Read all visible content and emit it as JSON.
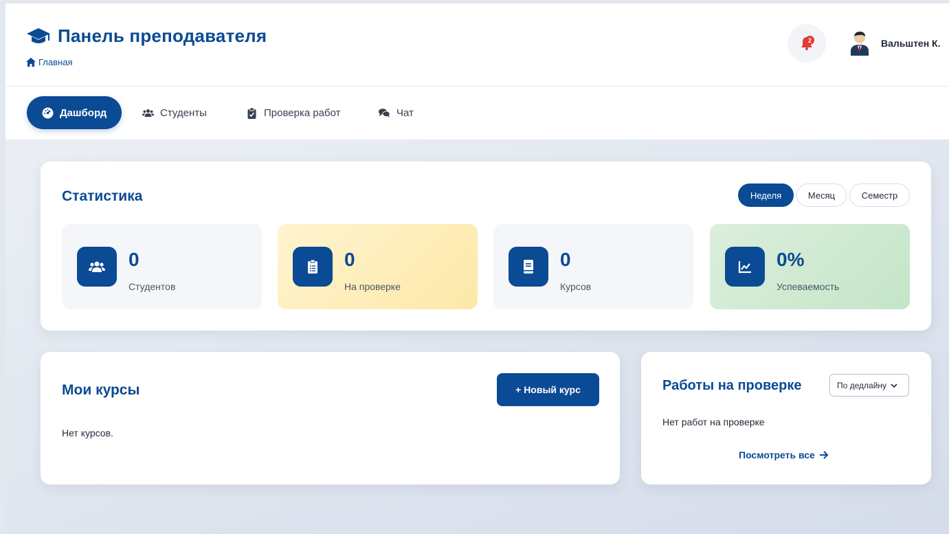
{
  "header": {
    "title": "Панель преподавателя",
    "breadcrumb": "Главная",
    "notifications_count": "2",
    "user_name": "Вальштен К."
  },
  "tabs": [
    {
      "label": "Дашборд",
      "icon": "dashboard-icon",
      "active": true
    },
    {
      "label": "Студенты",
      "icon": "users-icon",
      "active": false
    },
    {
      "label": "Проверка работ",
      "icon": "clipboard-icon",
      "active": false
    },
    {
      "label": "Чат",
      "icon": "chat-icon",
      "active": false
    }
  ],
  "stats": {
    "title": "Статистика",
    "periods": [
      "Неделя",
      "Месяц",
      "Семестр"
    ],
    "active_period": "Неделя",
    "cards": [
      {
        "value": "0",
        "label": "Студентов",
        "icon": "users-icon"
      },
      {
        "value": "0",
        "label": "На проверке",
        "icon": "clipboard-list-icon"
      },
      {
        "value": "0",
        "label": "Курсов",
        "icon": "book-icon"
      },
      {
        "value": "0%",
        "label": "Успеваемость",
        "icon": "chart-line-icon"
      }
    ]
  },
  "courses": {
    "title": "Мои курсы",
    "new_button": "+ Новый курс",
    "empty": "Нет курсов."
  },
  "reviews": {
    "title": "Работы на проверке",
    "sort_selected": "По дедлайну",
    "empty": "Нет работ на проверке",
    "view_all": "Посмотреть все"
  },
  "colors": {
    "primary": "#0b4a94",
    "badge": "#e53935",
    "warning_bg": "#fde8a8",
    "success_bg": "#c4e5c8"
  }
}
